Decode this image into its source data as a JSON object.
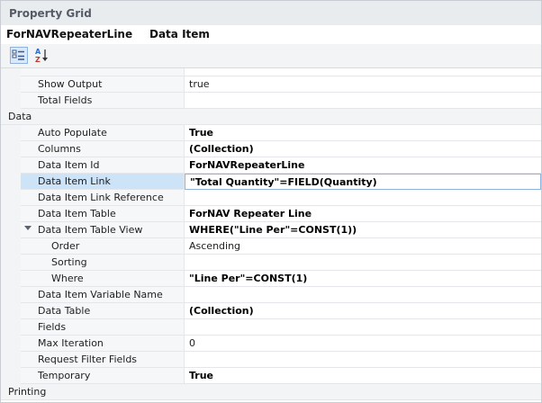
{
  "panel": {
    "title": "Property Grid"
  },
  "object": {
    "name": "ForNAVRepeaterLine",
    "type": "Data Item"
  },
  "toolbar": {
    "categorized_icon": "categorized-view-icon",
    "alphabetical_icon": "sort-az-icon"
  },
  "colors": {
    "selection": "#cde3f8",
    "selection_border": "#8fb3df",
    "header": "#e9ecef"
  },
  "rows": [
    {
      "kind": "property",
      "label": "Show Output",
      "value": "true",
      "bold": false,
      "indent": 1
    },
    {
      "kind": "property",
      "label": "Total Fields",
      "value": "",
      "bold": false,
      "indent": 1
    },
    {
      "kind": "category",
      "label": "Data"
    },
    {
      "kind": "property",
      "label": "Auto Populate",
      "value": "True",
      "bold": true,
      "indent": 1
    },
    {
      "kind": "property",
      "label": "Columns",
      "value": "(Collection)",
      "bold": true,
      "indent": 1
    },
    {
      "kind": "property",
      "label": "Data Item Id",
      "value": "ForNAVRepeaterLine",
      "bold": true,
      "indent": 1
    },
    {
      "kind": "property",
      "label": "Data Item Link",
      "value_bold": "\"Total Quantity\"",
      "value_rest": "=FIELD(Quantity)",
      "bold": true,
      "indent": 1,
      "selected": true
    },
    {
      "kind": "property",
      "label": "Data Item Link Reference",
      "value": "",
      "bold": false,
      "indent": 1
    },
    {
      "kind": "property",
      "label": "Data Item Table",
      "value": "ForNAV Repeater Line",
      "bold": true,
      "indent": 1
    },
    {
      "kind": "property",
      "label": "Data Item Table View",
      "value": "WHERE(\"Line Per\"=CONST(1))",
      "bold": true,
      "indent": 1,
      "expanded": true
    },
    {
      "kind": "property",
      "label": "Order",
      "value": "Ascending",
      "bold": false,
      "indent": 2
    },
    {
      "kind": "property",
      "label": "Sorting",
      "value": "",
      "bold": false,
      "indent": 2
    },
    {
      "kind": "property",
      "label": "Where",
      "value": "\"Line Per\"=CONST(1)",
      "bold": true,
      "indent": 2
    },
    {
      "kind": "property",
      "label": "Data Item Variable Name",
      "value": "",
      "bold": false,
      "indent": 1
    },
    {
      "kind": "property",
      "label": "Data Table",
      "value": "(Collection)",
      "bold": true,
      "indent": 1
    },
    {
      "kind": "property",
      "label": "Fields",
      "value": "",
      "bold": false,
      "indent": 1
    },
    {
      "kind": "property",
      "label": "Max Iteration",
      "value": "0",
      "bold": false,
      "indent": 1
    },
    {
      "kind": "property",
      "label": "Request Filter Fields",
      "value": "",
      "bold": false,
      "indent": 1
    },
    {
      "kind": "property",
      "label": "Temporary",
      "value": "True",
      "bold": true,
      "indent": 1
    },
    {
      "kind": "category",
      "label": "Printing"
    }
  ]
}
